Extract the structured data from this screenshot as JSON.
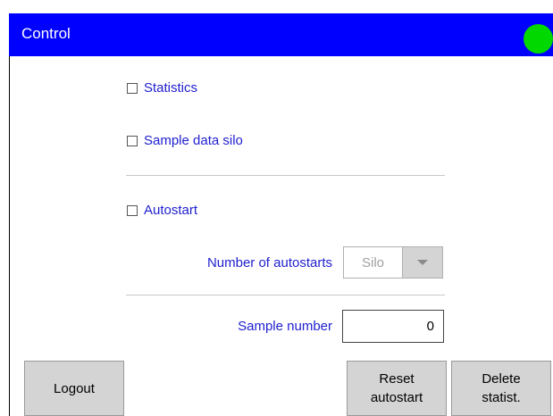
{
  "window": {
    "title": "Control",
    "status_color": "#00d800",
    "title_bar_color": "#0000ff"
  },
  "options": {
    "statistics_label": "Statistics",
    "statistics_checked": false,
    "sample_data_silo_label": "Sample data silo",
    "sample_data_silo_checked": false,
    "autostart_label": "Autostart",
    "autostart_checked": false
  },
  "autostarts": {
    "label": "Number of autostarts",
    "selected": "Silo"
  },
  "sample": {
    "label": "Sample number",
    "value": "0"
  },
  "buttons": {
    "logout": "Logout",
    "reset_autostart": "Reset\nautostart",
    "delete_statistics": "Delete\nstatist."
  }
}
